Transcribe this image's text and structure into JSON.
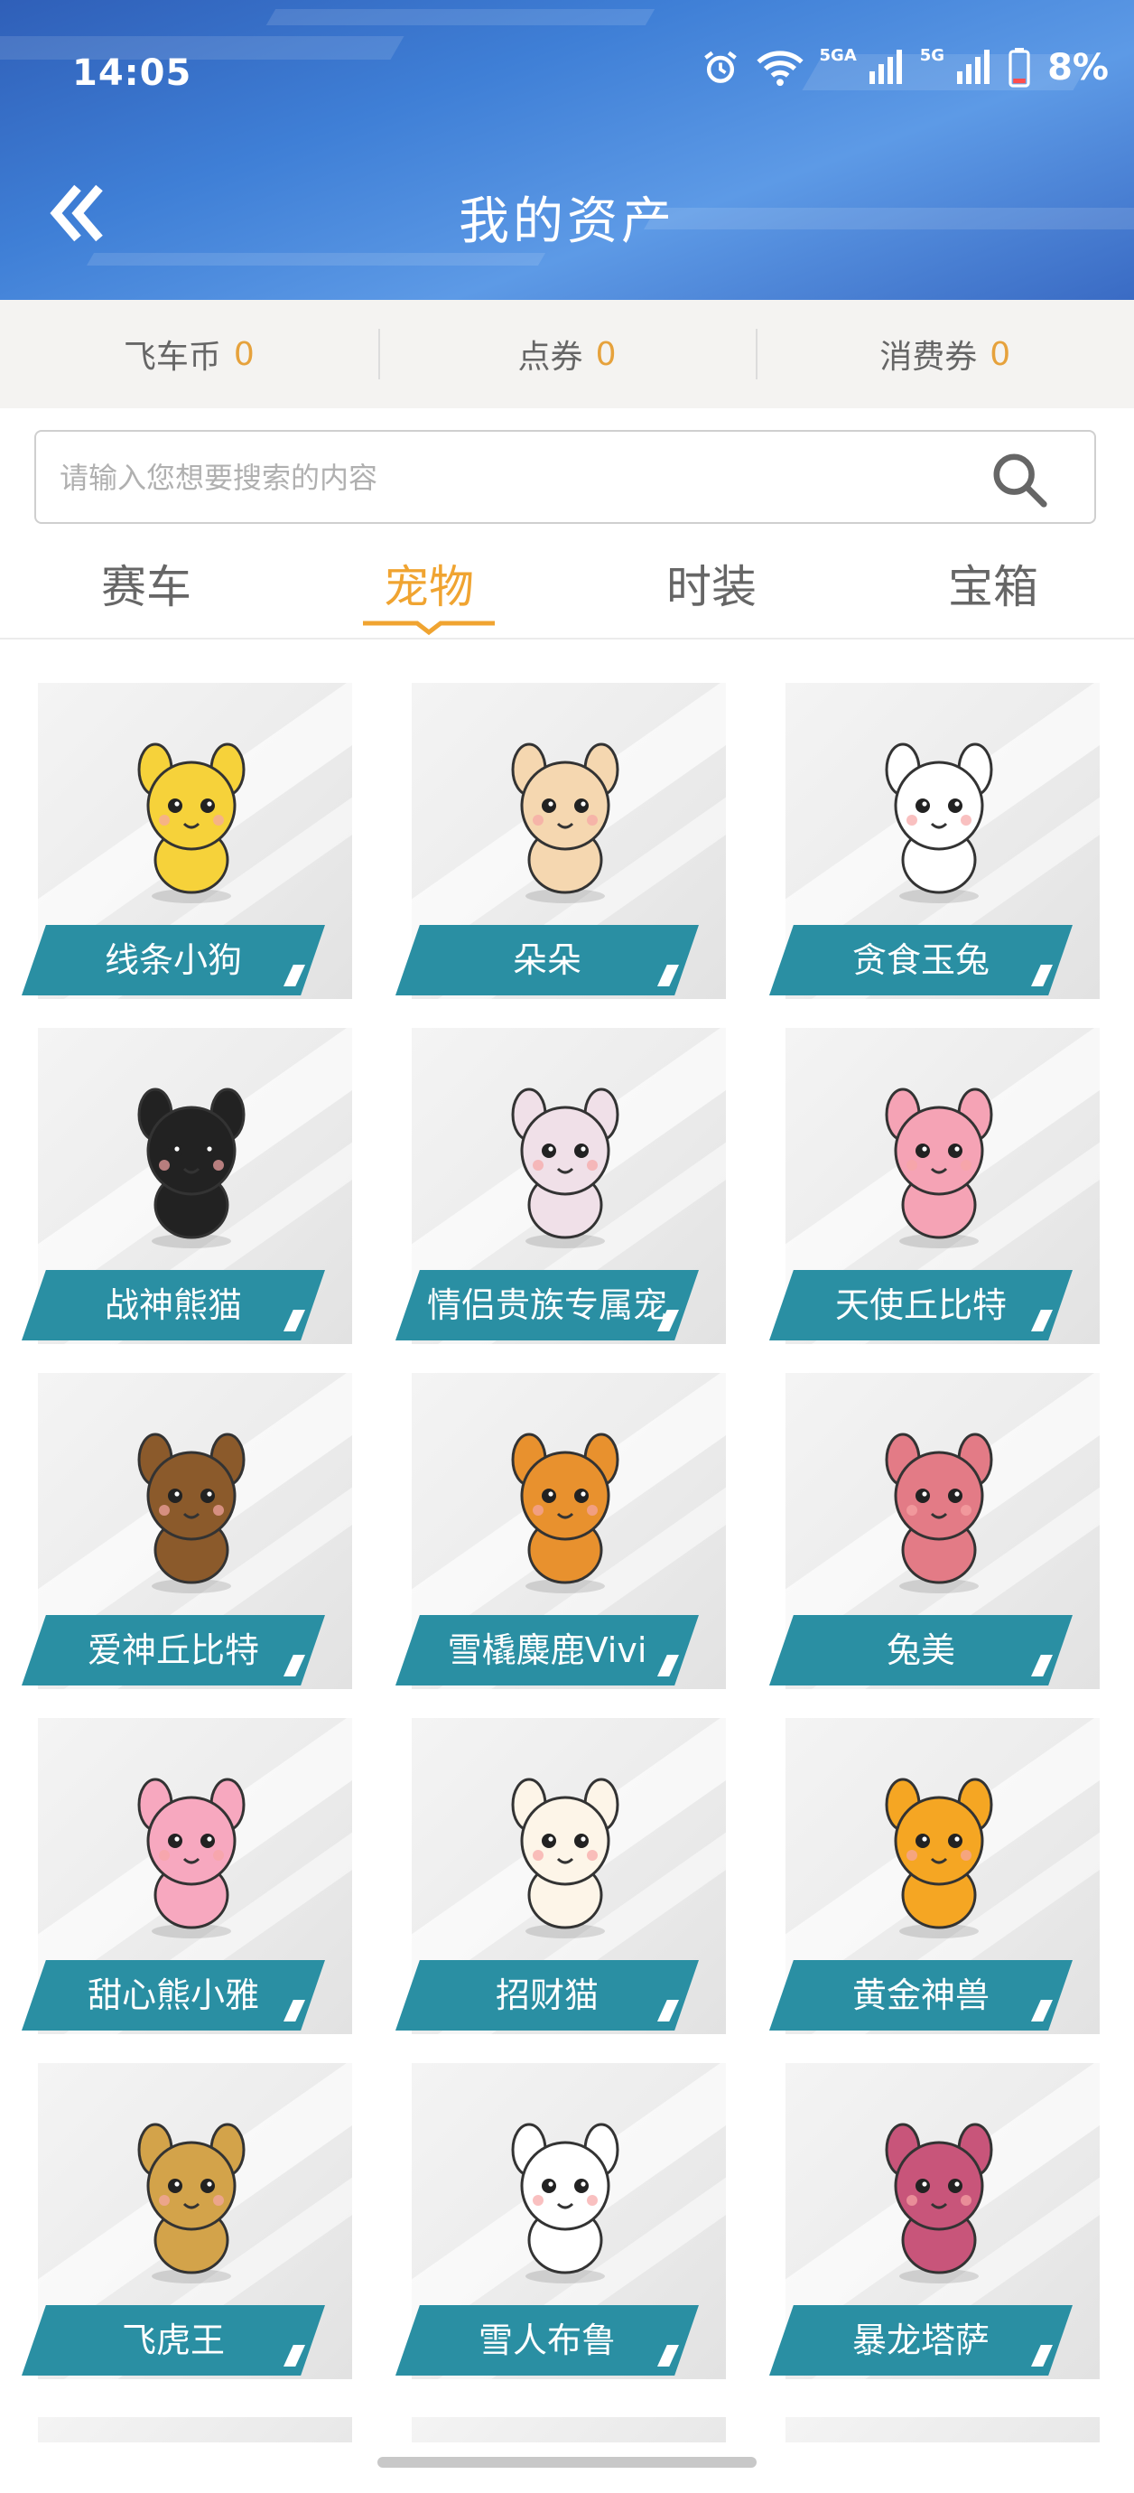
{
  "status_bar": {
    "time": "14:05",
    "signal_label_1": "5GA",
    "signal_label_2": "5G",
    "battery": "8%",
    "icons": [
      "alarm-icon",
      "wifi-icon",
      "signal-icon",
      "signal-icon",
      "battery-icon"
    ]
  },
  "header": {
    "title": "我的资产",
    "back_icon": "double-chevron-left-icon"
  },
  "currencies": [
    {
      "label": "飞车币",
      "value": "0"
    },
    {
      "label": "点券",
      "value": "0"
    },
    {
      "label": "消费券",
      "value": "0"
    }
  ],
  "search": {
    "placeholder": "请输入您想要搜索的内容",
    "icon": "search-icon"
  },
  "tabs": [
    {
      "label": "赛车",
      "active": false
    },
    {
      "label": "宠物",
      "active": true
    },
    {
      "label": "时装",
      "active": false
    },
    {
      "label": "宝箱",
      "active": false
    }
  ],
  "pets": [
    {
      "name": "线条小狗",
      "color": "#f6d23a"
    },
    {
      "name": "朵朵",
      "color": "#f5d7b0"
    },
    {
      "name": "贪食玉兔",
      "color": "#ffffff"
    },
    {
      "name": "战神熊猫",
      "color": "#222222"
    },
    {
      "name": "情侣贵族专属宠",
      "color": "#f0e0e8"
    },
    {
      "name": "天使丘比特",
      "color": "#f5a3b5"
    },
    {
      "name": "爱神丘比特",
      "color": "#8b5a2b"
    },
    {
      "name": "雪橇麋鹿Vivi",
      "color": "#e8912e"
    },
    {
      "name": "兔美",
      "color": "#e37b86"
    },
    {
      "name": "甜心熊小雅",
      "color": "#f7a8bf"
    },
    {
      "name": "招财猫",
      "color": "#fdf5e8"
    },
    {
      "name": "黄金神兽",
      "color": "#f5a623"
    },
    {
      "name": "飞虎王",
      "color": "#d3a34a"
    },
    {
      "name": "雪人布鲁",
      "color": "#ffffff"
    },
    {
      "name": "暴龙塔萨",
      "color": "#c8557a"
    }
  ],
  "colors": {
    "accent": "#f0a431",
    "label_bg": "#2a8fa3",
    "currency_value": "#e6a23c"
  }
}
